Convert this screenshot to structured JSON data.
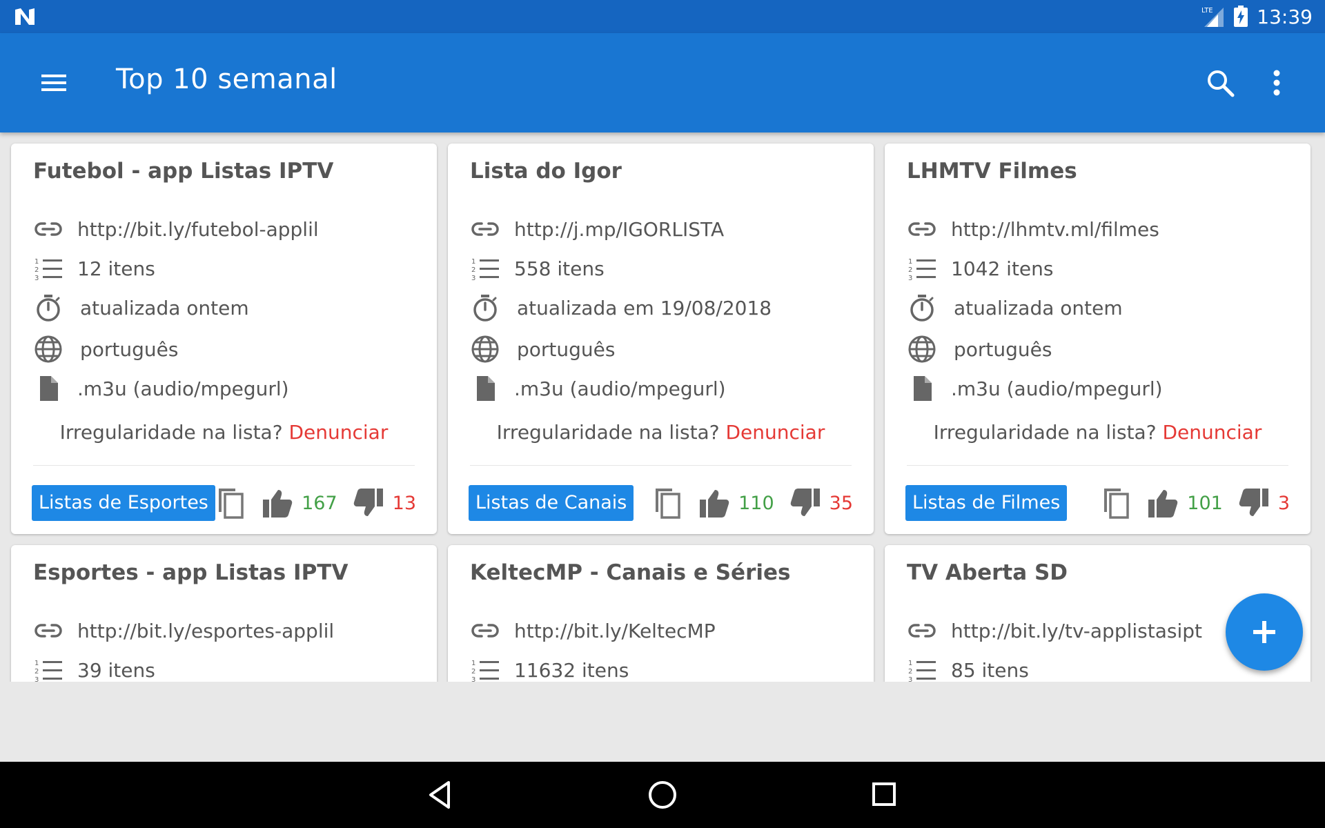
{
  "status_bar": {
    "network": "LTE",
    "time": "13:39"
  },
  "app_bar": {
    "title": "Top 10 semanal"
  },
  "cards": [
    {
      "title": "Futebol - app Listas IPTV",
      "url": "http://bit.ly/futebol-applil",
      "items": "12 itens",
      "updated": "atualizada ontem",
      "language": "português",
      "format": ".m3u (audio/mpegurl)",
      "report_text": "Irregularidade na lista?",
      "report_link": "Denunciar",
      "category": "Listas de Esportes",
      "upvotes": "167",
      "downvotes": "13"
    },
    {
      "title": "Lista do Igor",
      "url": "http://j.mp/IGORLISTA",
      "items": "558 itens",
      "updated": "atualizada em 19/08/2018",
      "language": "português",
      "format": ".m3u (audio/mpegurl)",
      "report_text": "Irregularidade na lista?",
      "report_link": "Denunciar",
      "category": "Listas de Canais",
      "upvotes": "110",
      "downvotes": "35"
    },
    {
      "title": "LHMTV Filmes",
      "url": "http://lhmtv.ml/filmes",
      "items": "1042 itens",
      "updated": "atualizada ontem",
      "language": "português",
      "format": ".m3u (audio/mpegurl)",
      "report_text": "Irregularidade na lista?",
      "report_link": "Denunciar",
      "category": "Listas de Filmes",
      "upvotes": "101",
      "downvotes": "3"
    },
    {
      "title": "Esportes - app Listas IPTV",
      "url": "http://bit.ly/esportes-applil",
      "items": "39 itens"
    },
    {
      "title": "KeltecMP - Canais e Séries",
      "url": "http://bit.ly/KeltecMP",
      "items": "11632 itens"
    },
    {
      "title": "TV Aberta SD",
      "url": "http://bit.ly/tv-applistasipt",
      "items": "85 itens"
    }
  ],
  "colors": {
    "status_bar": "#1565c0",
    "app_bar": "#1976d2",
    "accent": "#1e88e5",
    "upvote": "#43a047",
    "downvote": "#e53935",
    "background": "#e8e8e8"
  },
  "icons": {
    "menu": "menu-icon",
    "search": "search-icon",
    "more": "more-vert-icon",
    "link": "link-icon",
    "list": "list-numbered-icon",
    "timer": "timer-icon",
    "language": "globe-icon",
    "file": "file-icon",
    "copy": "copy-icon",
    "thumb_up": "thumb-up-icon",
    "thumb_down": "thumb-down-icon",
    "fab": "add-icon"
  }
}
